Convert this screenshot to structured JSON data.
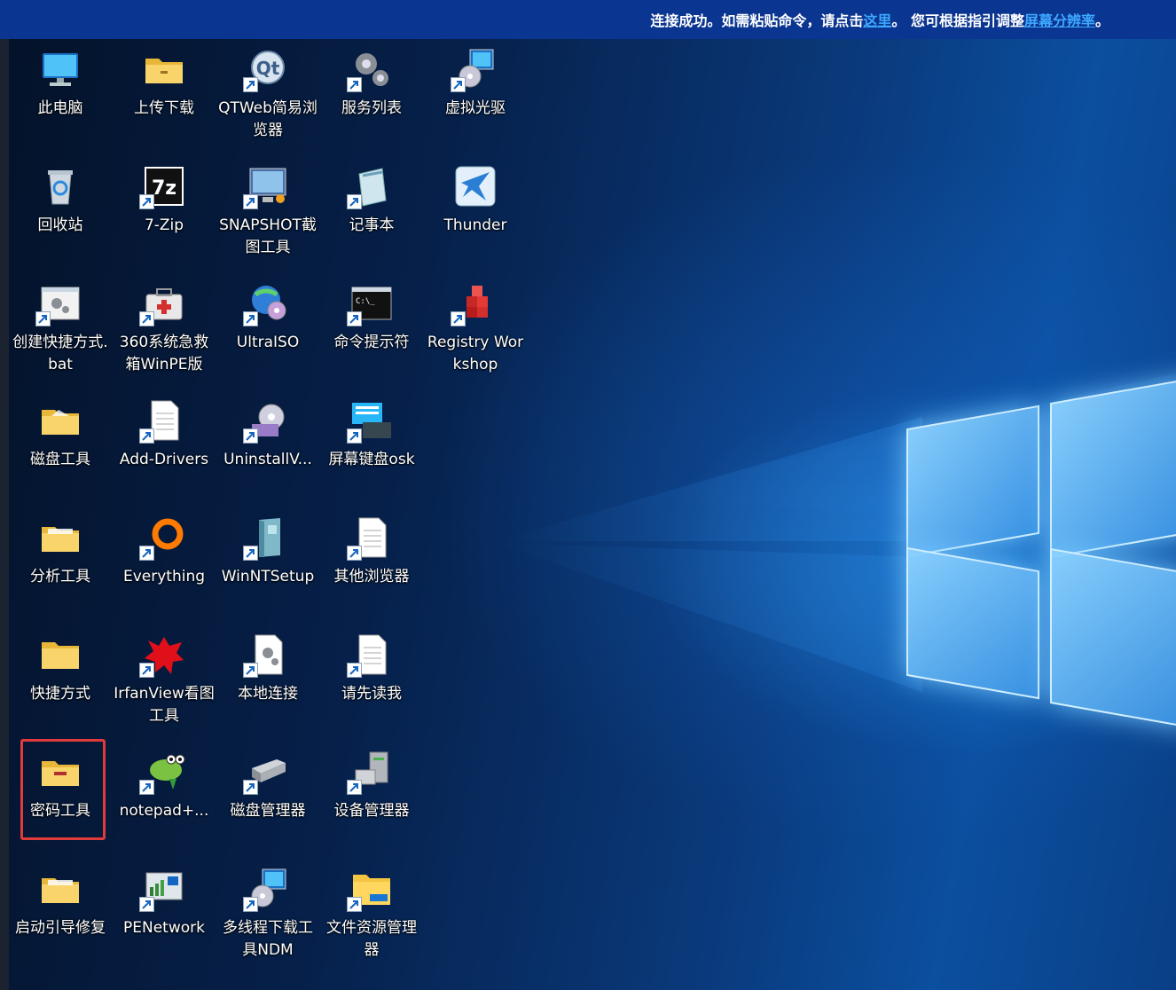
{
  "banner": {
    "text_part1": "连接成功。如需粘贴命令，请点击",
    "link1": "这里",
    "text_part2": "。 您可根据指引调整",
    "link2": "屏幕分辨率",
    "text_part3": "。",
    "link_color": "#3ea8ff"
  },
  "icons": [
    {
      "label": "此电脑",
      "icon": "computer-icon"
    },
    {
      "label": "上传下载",
      "icon": "folder-icon"
    },
    {
      "label": "QTWeb简易浏览器",
      "icon": "qt-browser-icon"
    },
    {
      "label": "服务列表",
      "icon": "gears-icon"
    },
    {
      "label": "虚拟光驱",
      "icon": "virtual-drive-icon"
    },
    {
      "label": "回收站",
      "icon": "recycle-bin-icon"
    },
    {
      "label": "7-Zip",
      "icon": "7zip-icon"
    },
    {
      "label": "SNAPSHOT截图工具",
      "icon": "snapshot-icon"
    },
    {
      "label": "记事本",
      "icon": "notepad-icon"
    },
    {
      "label": "Thunder",
      "icon": "thunder-icon"
    },
    {
      "label": "创建快捷方式.bat",
      "icon": "batch-file-icon"
    },
    {
      "label": "360系统急救箱WinPE版",
      "icon": "first-aid-kit-icon"
    },
    {
      "label": "UltraISO",
      "icon": "ultraiso-icon"
    },
    {
      "label": "命令提示符",
      "icon": "command-prompt-icon"
    },
    {
      "label": "Registry Workshop",
      "icon": "registry-icon"
    },
    {
      "label": "磁盘工具",
      "icon": "folder-icon"
    },
    {
      "label": "Add-Drivers",
      "icon": "document-icon"
    },
    {
      "label": "UninstallV...",
      "icon": "uninstall-icon"
    },
    {
      "label": "屏幕键盘osk",
      "icon": "keyboard-icon"
    },
    {
      "label": "分析工具",
      "icon": "folder-icon"
    },
    {
      "label": "Everything",
      "icon": "everything-search-icon"
    },
    {
      "label": "WinNTSetup",
      "icon": "winntsetup-icon"
    },
    {
      "label": "其他浏览器",
      "icon": "document-icon"
    },
    {
      "label": "快捷方式",
      "icon": "folder-icon"
    },
    {
      "label": "IrfanView看图工具",
      "icon": "irfanview-icon"
    },
    {
      "label": "本地连接",
      "icon": "settings-file-icon"
    },
    {
      "label": "请先读我",
      "icon": "document-icon"
    },
    {
      "label": "密码工具",
      "icon": "folder-icon"
    },
    {
      "label": "notepad+...",
      "icon": "notepad-plus-plus-icon"
    },
    {
      "label": "磁盘管理器",
      "icon": "disk-manager-icon"
    },
    {
      "label": "设备管理器",
      "icon": "device-manager-icon"
    },
    {
      "label": "启动引导修复",
      "icon": "folder-icon"
    },
    {
      "label": "PENetwork",
      "icon": "network-icon"
    },
    {
      "label": "多线程下载工具NDM",
      "icon": "download-manager-icon"
    },
    {
      "label": "文件资源管理器",
      "icon": "file-explorer-icon"
    }
  ],
  "selected_icon": "密码工具",
  "colors": {
    "banner_bg": "#0a3590",
    "selection_border": "#e23b3b",
    "folder_yellow": "#f4c542"
  }
}
